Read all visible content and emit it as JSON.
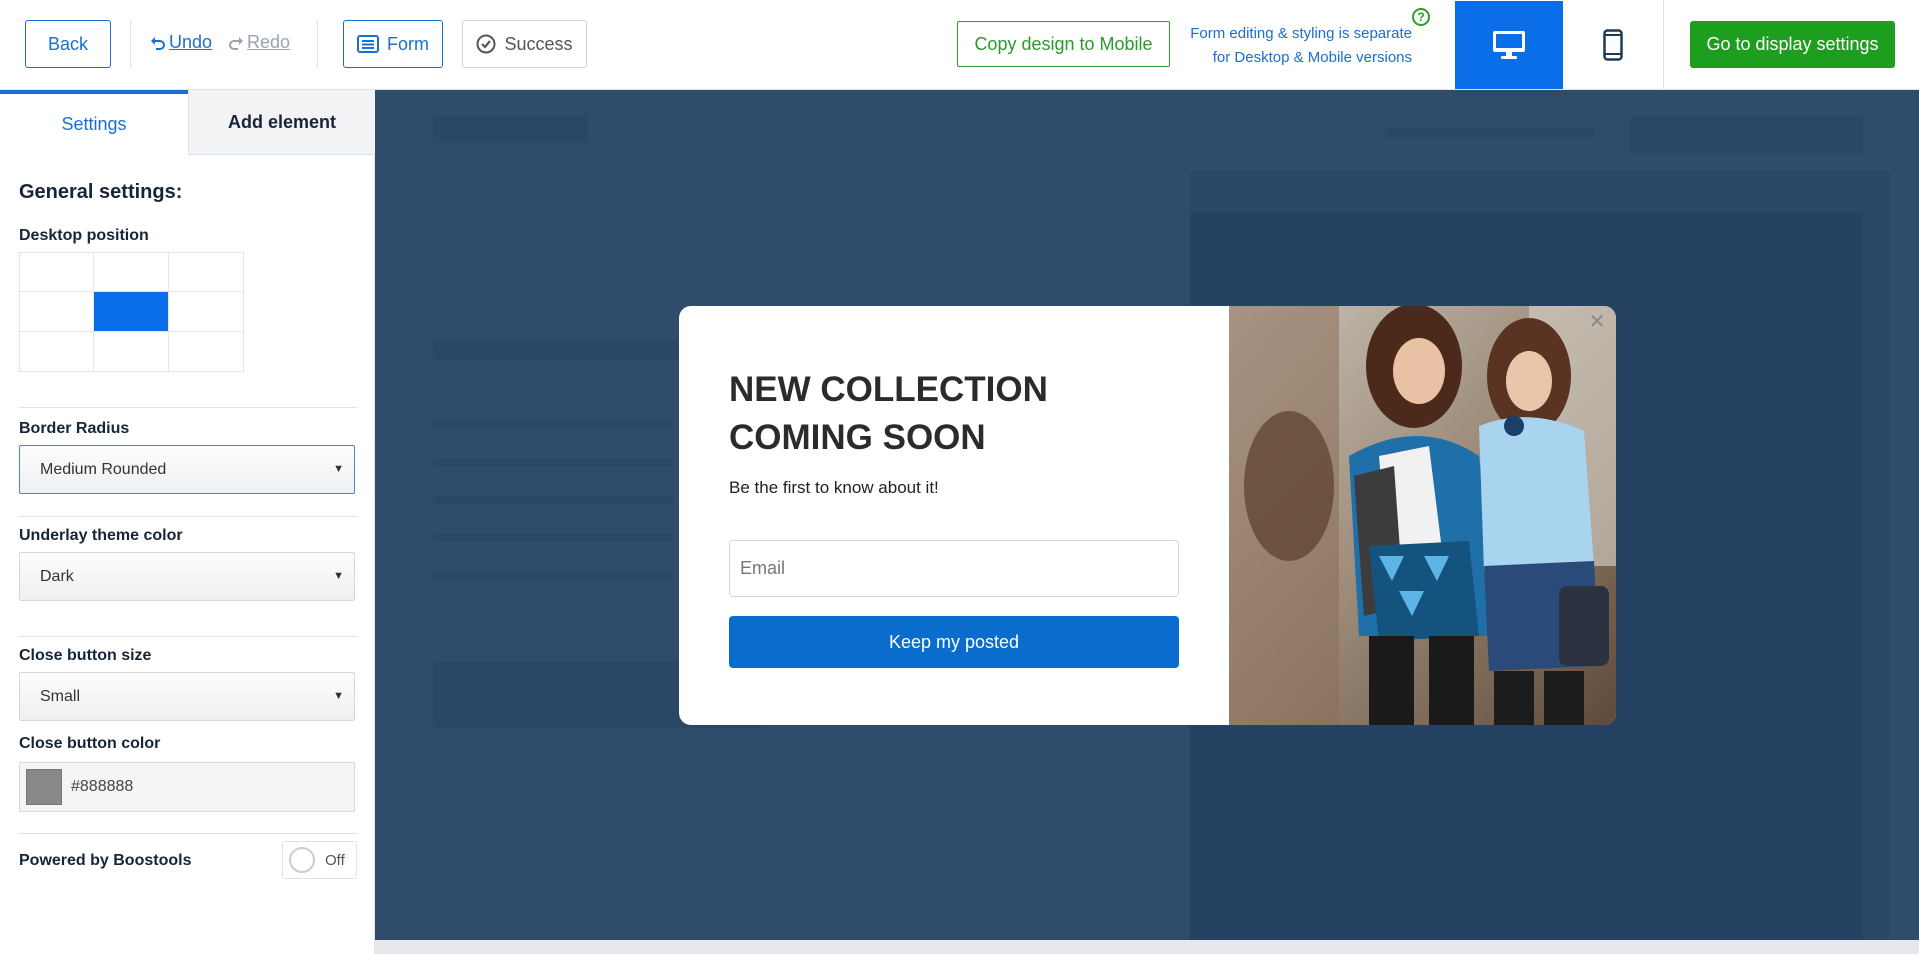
{
  "topbar": {
    "back_label": "Back",
    "undo_label": "Undo",
    "redo_label": "Redo",
    "form_label": "Form",
    "success_label": "Success",
    "copy_label": "Copy design to Mobile",
    "separate_note_line1": "Form editing & styling is separate",
    "separate_note_line2": "for Desktop & Mobile versions",
    "help_glyph": "?",
    "go_label": "Go to display settings",
    "device_active": "desktop"
  },
  "sidebar": {
    "tabs": [
      {
        "label": "Settings",
        "active": true
      },
      {
        "label": "Add element",
        "active": false
      }
    ],
    "general_heading": "General settings:",
    "desktop_position_label": "Desktop position",
    "desktop_position_selected": "middle-center",
    "border_radius_label": "Border Radius",
    "border_radius_value": "Medium Rounded",
    "underlay_label": "Underlay theme color",
    "underlay_value": "Dark",
    "close_size_label": "Close button size",
    "close_size_value": "Small",
    "close_color_label": "Close button color",
    "close_color_value": "#888888",
    "powered_label": "Powered by Boostools",
    "powered_toggle": "Off"
  },
  "popup": {
    "title_line1": "NEW COLLECTION",
    "title_line2": "COMING SOON",
    "subtitle": "Be the first to know about it!",
    "email_placeholder": "Email",
    "button_label": "Keep my posted",
    "close_glyph": "✕"
  },
  "colors": {
    "accent": "#0a6ee8",
    "success_green": "#1e9e1e",
    "canvas_bg": "#2f4d6b",
    "popup_button": "#0a6ccd",
    "close_color": "#888888"
  }
}
